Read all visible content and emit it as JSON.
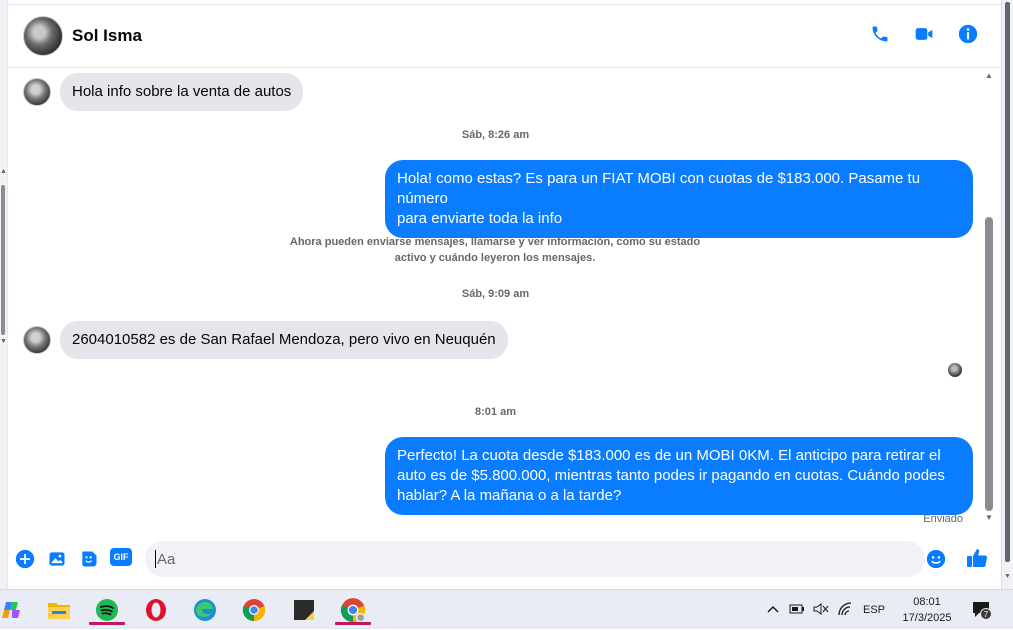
{
  "contact": {
    "name": "Sol Isma"
  },
  "header_icons": [
    "phone-icon",
    "video-camera-icon",
    "info-icon"
  ],
  "messages": [
    {
      "direction": "in",
      "text": "Hola info sobre la venta de autos"
    },
    {
      "type": "timestamp",
      "text": "Sáb, 8:26 am"
    },
    {
      "direction": "out",
      "lines": [
        "Hola! como estas? Es para un FIAT MOBI con cuotas de $183.000. Pasame tu número",
        "para enviarte toda la info"
      ]
    },
    {
      "type": "notice",
      "lines": [
        "Ahora pueden enviarse mensajes, llamarse y ver información, como su estado",
        "activo y cuándo leyeron los mensajes."
      ]
    },
    {
      "type": "timestamp",
      "text": "Sáb, 9:09 am"
    },
    {
      "direction": "in",
      "text": "2604010582 es de San Rafael Mendoza, pero vivo en Neuquén"
    },
    {
      "type": "timestamp",
      "text": "8:01 am"
    },
    {
      "direction": "out",
      "lines": [
        "Perfecto! La cuota desde $183.000 es de un MOBI 0KM. El anticipo para retirar el",
        "auto es de $5.800.000, mientras tanto podes ir pagando en cuotas. Cuándo podes",
        "hablar? A la mañana o a la tarde?"
      ]
    }
  ],
  "status": "Enviado",
  "composer": {
    "placeholder": "Aa",
    "icons": [
      "add-icon",
      "photo-icon",
      "sticker-icon",
      "gif-icon",
      "emoji-icon",
      "like-icon"
    ],
    "gif_label": "GIF"
  },
  "taskbar": {
    "apps": [
      "copilot-icon",
      "file-explorer-icon",
      "spotify-icon",
      "opera-icon",
      "edge-icon",
      "chrome-icon",
      "sticky-notes-icon",
      "chrome-profile-icon"
    ],
    "tray": {
      "language": "ESP",
      "time": "08:01",
      "date": "17/3/2025",
      "notifications": "7"
    }
  },
  "colors": {
    "accent": "#0a7cff",
    "incoming_bubble": "#e4e6eb",
    "text": "#050505",
    "muted": "#65676b"
  }
}
